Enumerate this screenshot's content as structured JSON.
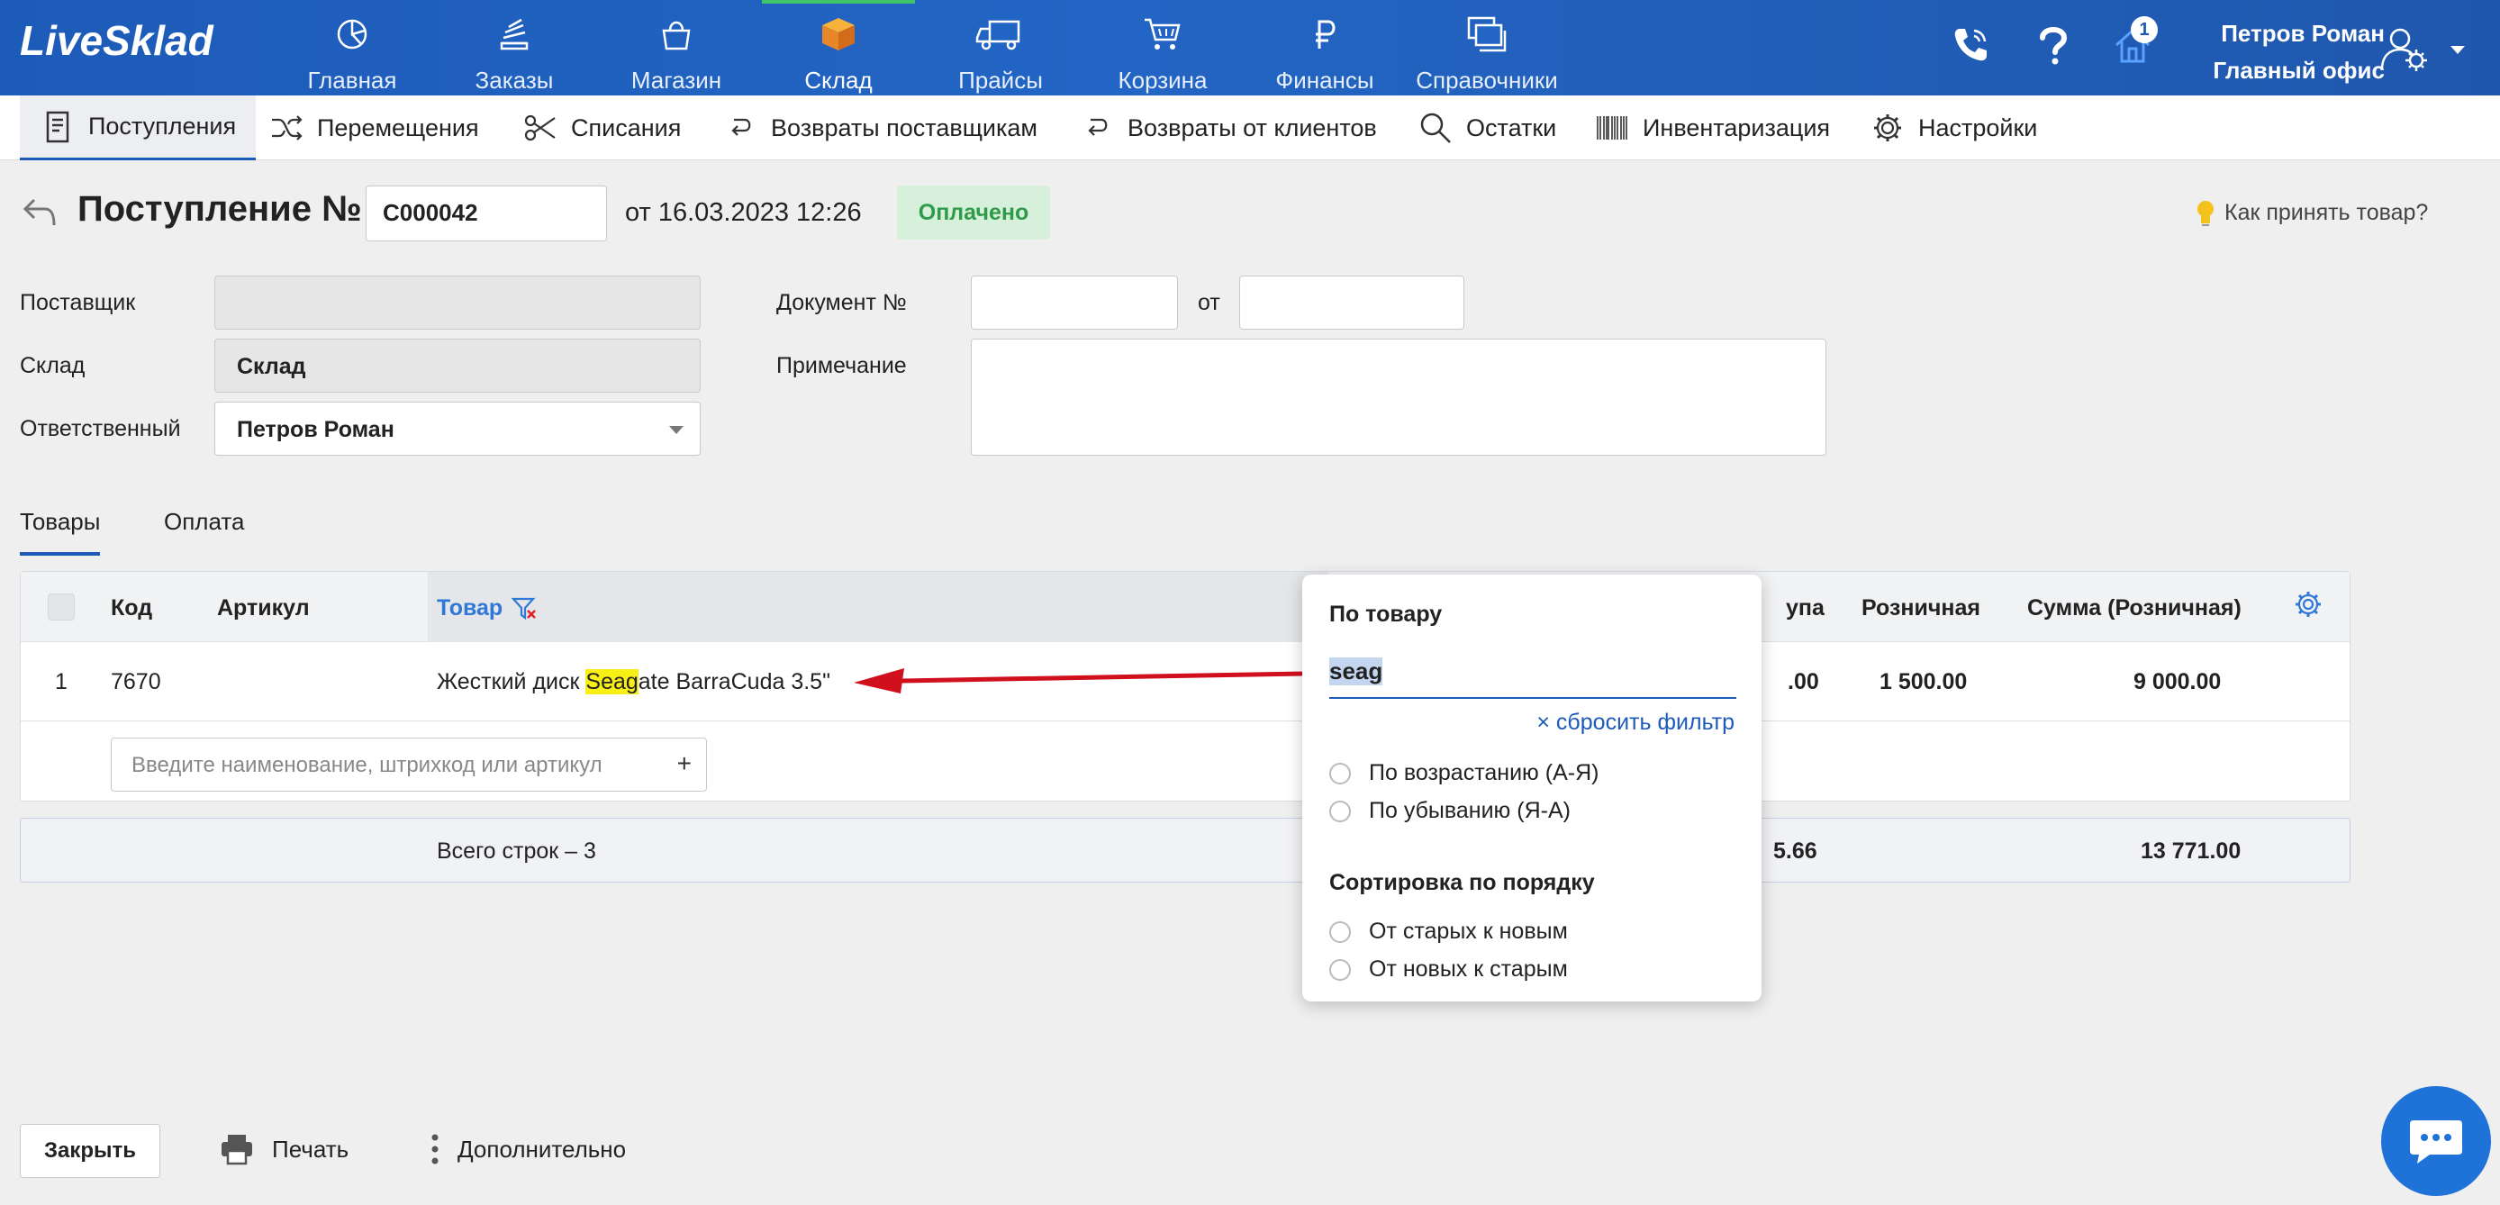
{
  "app": {
    "logo": "LiveSklad"
  },
  "nav": {
    "items": [
      {
        "label": "Главная",
        "icon": "pie-chart-icon"
      },
      {
        "label": "Заказы",
        "icon": "orders-icon"
      },
      {
        "label": "Магазин",
        "icon": "shopping-bag-icon"
      },
      {
        "label": "Склад",
        "icon": "box-icon",
        "active": true
      },
      {
        "label": "Прайсы",
        "icon": "truck-icon"
      },
      {
        "label": "Корзина",
        "icon": "cart-icon"
      },
      {
        "label": "Финансы",
        "icon": "ruble-icon"
      },
      {
        "label": "Справочники",
        "icon": "directories-icon"
      }
    ]
  },
  "header_right": {
    "notification_count": "1",
    "user_name": "Петров Роман",
    "office": "Главный офис"
  },
  "submenu": {
    "items": [
      {
        "label": "Поступления",
        "icon": "receipt-icon",
        "active": true
      },
      {
        "label": "Перемещения",
        "icon": "shuffle-icon"
      },
      {
        "label": "Списания",
        "icon": "scissors-icon"
      },
      {
        "label": "Возвраты поставщикам",
        "icon": "return-icon"
      },
      {
        "label": "Возвраты от клиентов",
        "icon": "return-icon"
      },
      {
        "label": "Остатки",
        "icon": "search-icon"
      },
      {
        "label": "Инвентаризация",
        "icon": "barcode-icon"
      },
      {
        "label": "Настройки",
        "icon": "gear-icon"
      }
    ]
  },
  "document": {
    "title": "Поступление №",
    "number": "C000042",
    "date": "от 16.03.2023 12:26",
    "status": "Оплачено",
    "help_link": "Как принять товар?"
  },
  "form": {
    "supplier_label": "Поставщик",
    "supplier_value": "",
    "warehouse_label": "Склад",
    "warehouse_value": "Склад",
    "responsible_label": "Ответственный",
    "responsible_value": "Петров Роман",
    "doc_number_label": "Документ №",
    "doc_number_value": "",
    "from_label": "от",
    "from_value": "",
    "note_label": "Примечание",
    "note_value": ""
  },
  "tabs": [
    {
      "label": "Товары",
      "active": true
    },
    {
      "label": "Оплата"
    }
  ],
  "table": {
    "columns": {
      "code": "Код",
      "article": "Артикул",
      "product": "Товар",
      "purchase": "упа",
      "retail": "Розничная",
      "retail_sum": "Сумма (Розничная)"
    },
    "rows": [
      {
        "index": "1",
        "code": "7670",
        "article": "",
        "product_before": "Жесткий диск ",
        "product_highlight": "Seag",
        "product_after": "ate BarraCuda 3.5\"",
        "purchase": ".00",
        "retail": "1 500.00",
        "retail_sum": "9 000.00"
      }
    ],
    "add_placeholder": "Введите наименование, штрихкод или артикул",
    "add_plus": "+"
  },
  "totals": {
    "rows_text": "Всего строк – 3",
    "purchase_total": "5.66",
    "retail_sum_total": "13 771.00"
  },
  "filter_popup": {
    "title": "По товару",
    "search_value": "seag",
    "reset": "× сбросить фильтр",
    "sort_asc": "По возрастанию (А-Я)",
    "sort_desc": "По убыванию (Я-А)",
    "order_title": "Сортировка по порядку",
    "old_to_new": "От старых к новым",
    "new_to_old": "От новых к старым"
  },
  "footer": {
    "close": "Закрыть",
    "print": "Печать",
    "more": "Дополнительно"
  },
  "colors": {
    "brand": "#1d5bb8",
    "active_tab_accent": "#3fc46a",
    "paid_bg": "#d6f0dc",
    "paid_text": "#2f9b48",
    "highlight": "#f7ef15",
    "arrow": "#d0101d"
  }
}
